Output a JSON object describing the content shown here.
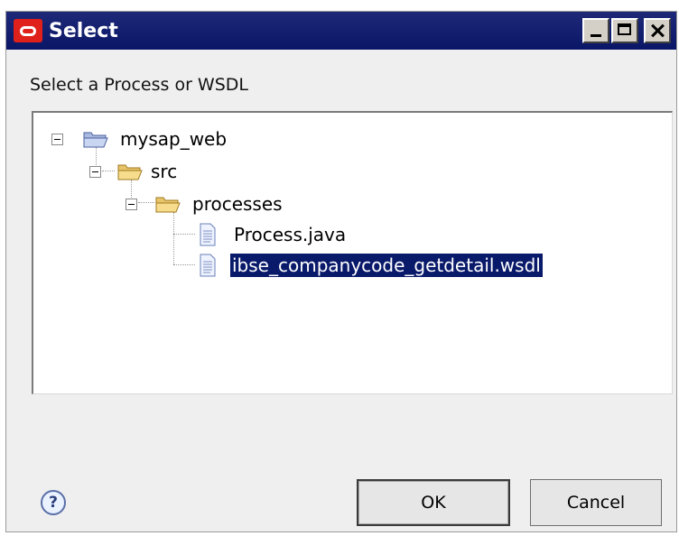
{
  "window": {
    "title": "Select",
    "buttons": [
      "minimize-icon",
      "maximize-icon",
      "close-icon"
    ]
  },
  "prompt": "Select a Process or WSDL",
  "tree": {
    "nodes": [
      {
        "label": "mysap_web",
        "type": "project-folder",
        "expanded": true,
        "level": 0
      },
      {
        "label": "src",
        "type": "folder",
        "expanded": true,
        "level": 1
      },
      {
        "label": "processes",
        "type": "folder",
        "expanded": true,
        "level": 2
      },
      {
        "label": "Process.java",
        "type": "file",
        "level": 3
      },
      {
        "label": "ibse_companycode_getdetail.wsdl",
        "type": "file",
        "level": 3,
        "selected": true
      }
    ]
  },
  "footer": {
    "help": "?",
    "ok_label": "OK",
    "cancel_label": "Cancel"
  },
  "colors": {
    "titlebar": "#0a1666",
    "selection": "#0a1a6a",
    "app_icon": "#e0211b"
  }
}
